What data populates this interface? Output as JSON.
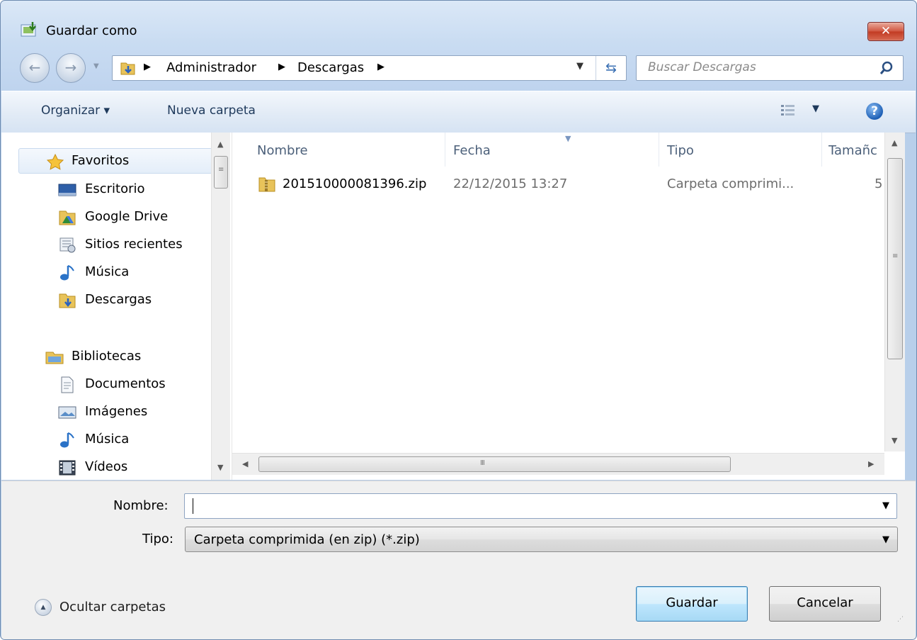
{
  "window": {
    "title": "Guardar como",
    "close_label": "✕"
  },
  "navigation": {
    "breadcrumbs": [
      "Administrador",
      "Descargas"
    ],
    "search_placeholder": "Buscar Descargas"
  },
  "toolbar": {
    "organize_label": "Organizar ▾",
    "new_folder_label": "Nueva carpeta",
    "help_label": "?"
  },
  "sidebar": {
    "favorites_header": "Favoritos",
    "favorites": [
      "Escritorio",
      "Google Drive",
      "Sitios recientes",
      "Música",
      "Descargas"
    ],
    "libraries_header": "Bibliotecas",
    "libraries": [
      "Documentos",
      "Imágenes",
      "Música",
      "Vídeos"
    ]
  },
  "file_list": {
    "columns": [
      "Nombre",
      "Fecha",
      "Tipo",
      "Tamañc"
    ],
    "rows": [
      {
        "name": "201510000081396.zip",
        "date": "22/12/2015 13:27",
        "type": "Carpeta comprimi...",
        "size": "5"
      }
    ],
    "hscroll_grip": "III"
  },
  "form": {
    "name_label": "Nombre:",
    "name_value": "",
    "type_label": "Tipo:",
    "type_value": "Carpeta comprimida (en zip) (*.zip)"
  },
  "footer": {
    "hide_folders_label": "Ocultar carpetas",
    "save_label": "Guardar",
    "cancel_label": "Cancelar"
  },
  "colors": {
    "accent": "#3c7fb1",
    "close": "#c23a22",
    "chrome": "#c9dcf2"
  }
}
